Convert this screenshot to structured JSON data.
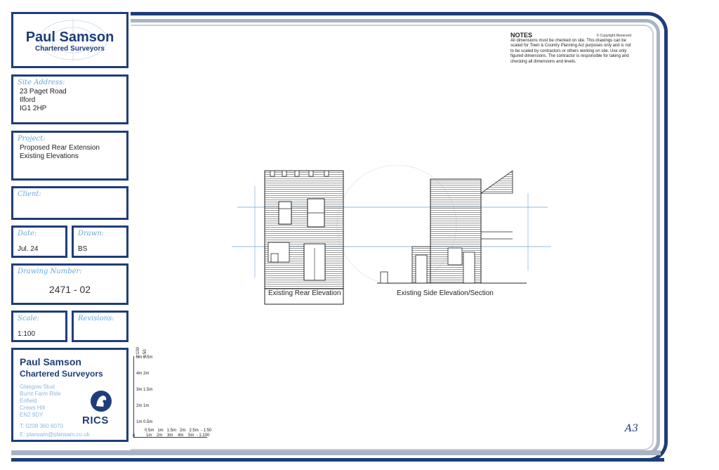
{
  "company": {
    "name": "Paul Samson",
    "subtitle": "Chartered Surveyors"
  },
  "site": {
    "label": "Site Address:",
    "line1": "23 Paget Road",
    "line2": "Ilford",
    "line3": "IG1 2HP"
  },
  "project": {
    "label": "Project:",
    "line1": "Proposed Rear Extension",
    "line2": "Existing Elevations"
  },
  "client": {
    "label": "Client:"
  },
  "date": {
    "label": "Date:",
    "value": "Jul. 24"
  },
  "drawn": {
    "label": "Drawn:",
    "value": "BS"
  },
  "drawing_number": {
    "label": "Drawing Number:",
    "value": "2471 - 02"
  },
  "scale": {
    "label": "Scale:",
    "value": "1:100"
  },
  "revisions": {
    "label": "Revisions:"
  },
  "contact": {
    "name": "Paul Samson",
    "subtitle": "Chartered Surveyors",
    "address1": "Glasgow Stud",
    "address2": "Burnt Farm Ride",
    "address3": "Enfield",
    "address4": "Crews Hill",
    "address5": "EN2 9DY",
    "phone": "T: 0208 360 6070",
    "email": "E: plansam@plansam.co.uk",
    "rics": "RICS"
  },
  "notes": {
    "title": "NOTES",
    "copyright": "© Copyright Reserved",
    "text": "All dimensions must be checked on site. This drawings can be scaled for Town & Country Planning Act purposes only and is not to be scaled by contractors or others working on site. Use only figured dimensions. The contractor is responsible for taking and checking all dimensions and levels."
  },
  "drawings": {
    "rear_caption": "Existing Rear Elevation",
    "side_caption": "Existing Side Elevation/Section"
  },
  "scale_bar": {
    "vert_100": "1:100",
    "vert_50": "1:50",
    "v5": "5m 2.5m",
    "v4": "4m  2m",
    "v3": "3m 1.5m",
    "v2": "2m  1m",
    "v1": "1m 0.5m",
    "zero": "0",
    "h_top": "0.5m   1m   1.5m   2m   2.5m  - 1:50",
    "h_bottom": "1m    2m    3m    4m    5m  - 1:100"
  },
  "sheet_size": "A3",
  "colors": {
    "navy": "#1f3d7a",
    "light_blue": "#6aa6d8",
    "grey_frame": "#a9b4c3"
  }
}
